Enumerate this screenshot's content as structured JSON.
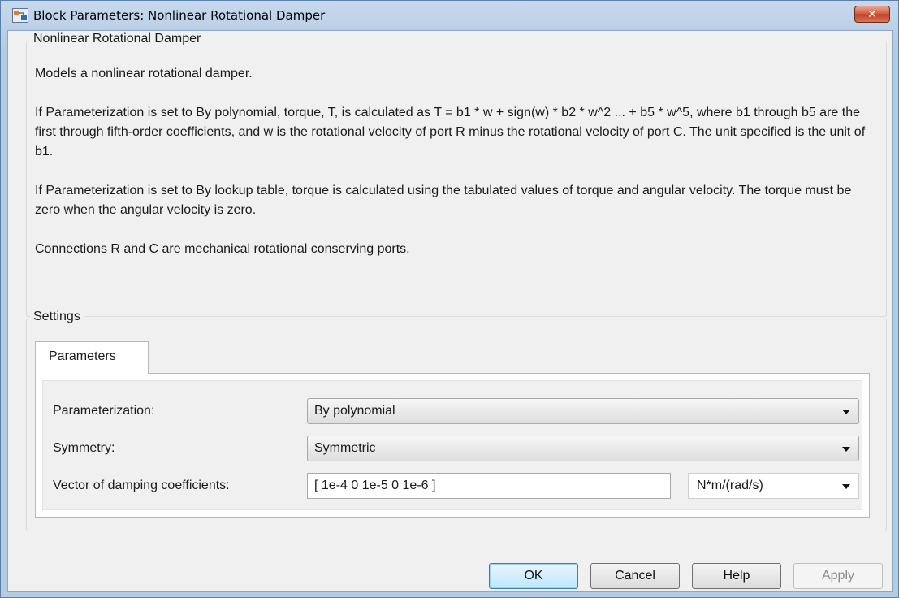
{
  "window": {
    "title": "Block Parameters: Nonlinear Rotational Damper",
    "close_label": "✕"
  },
  "description": {
    "group_label": "Nonlinear Rotational Damper",
    "paragraphs": [
      "Models a nonlinear rotational damper.",
      "If Parameterization is set to By polynomial, torque, T, is calculated as T = b1 * w + sign(w) * b2 * w^2 ... + b5 * w^5, where b1 through b5 are the first through fifth-order coefficients, and w is the rotational velocity of port R minus the rotational velocity of port C. The unit specified is the unit of b1.",
      "If Parameterization is set to By lookup table, torque is calculated using the tabulated values of torque and angular velocity. The torque must be zero when the angular velocity is zero.",
      "Connections R and C are mechanical rotational conserving ports."
    ]
  },
  "settings": {
    "group_label": "Settings",
    "tab_label": "Parameters",
    "parameterization": {
      "label": "Parameterization:",
      "value": "By polynomial"
    },
    "symmetry": {
      "label": "Symmetry:",
      "value": "Symmetric"
    },
    "damping": {
      "label": "Vector of damping coefficients:",
      "value": "[ 1e-4 0 1e-5 0 1e-6 ]",
      "unit": "N*m/(rad/s)"
    }
  },
  "buttons": {
    "ok": "OK",
    "cancel": "Cancel",
    "help": "Help",
    "apply": "Apply"
  }
}
